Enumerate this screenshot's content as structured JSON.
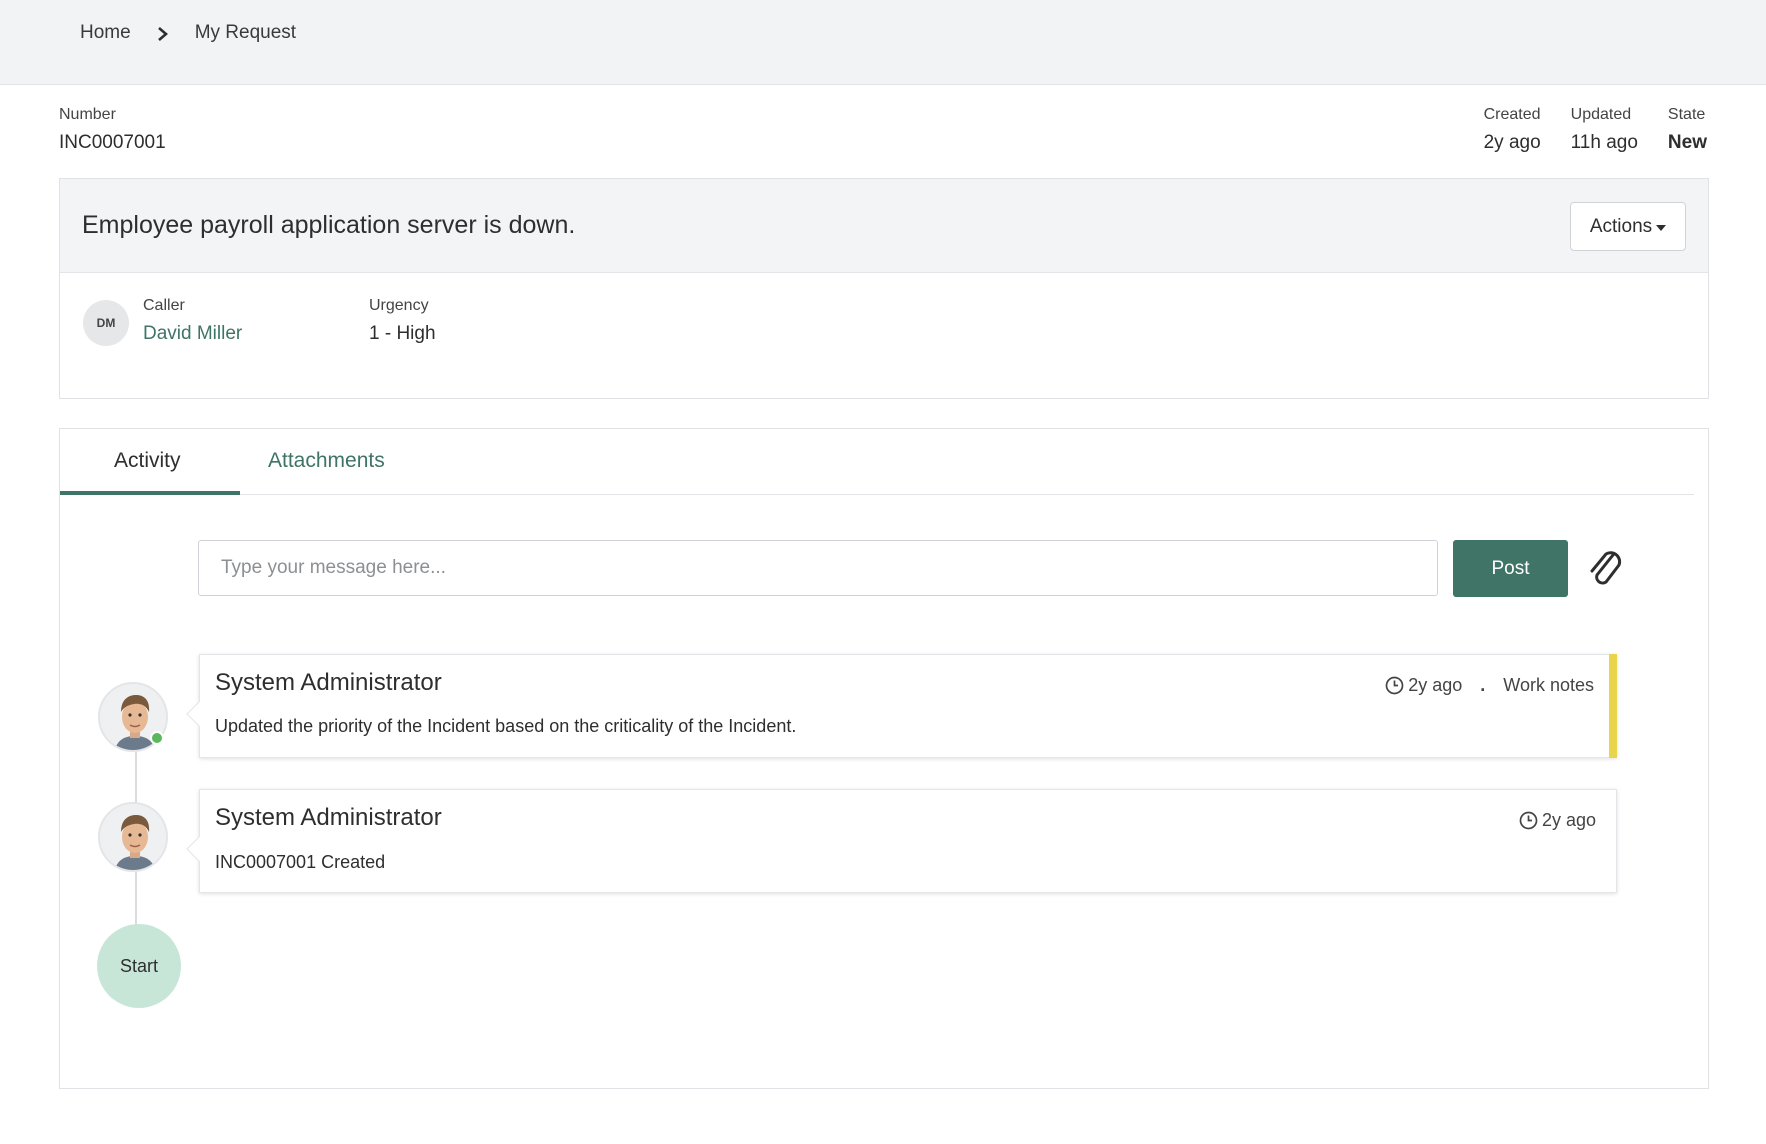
{
  "breadcrumb": {
    "home": "Home",
    "current": "My Request"
  },
  "ticket": {
    "number_label": "Number",
    "number": "INC0007001",
    "created_label": "Created",
    "created": "2y ago",
    "updated_label": "Updated",
    "updated": "11h ago",
    "state_label": "State",
    "state": "New"
  },
  "summary": {
    "title": "Employee payroll application server is down.",
    "actions_label": "Actions",
    "caller_initials": "DM",
    "caller_label": "Caller",
    "caller_name": "David Miller",
    "urgency_label": "Urgency",
    "urgency": "1 - High"
  },
  "tabs": {
    "activity": "Activity",
    "attachments": "Attachments"
  },
  "composer": {
    "placeholder": "Type your message here...",
    "post_label": "Post"
  },
  "timeline": {
    "entries": [
      {
        "author": "System Administrator",
        "time": "2y ago",
        "type": "Work notes",
        "text": "Updated the priority of the Incident based on the criticality of the Incident."
      },
      {
        "author": "System Administrator",
        "time": "2y ago",
        "text": "INC0007001 Created"
      }
    ],
    "start_label": "Start"
  },
  "colors": {
    "brand": "#3f7466",
    "work_notes_accent": "#e8d54a",
    "start_node": "#c7e6d8",
    "presence": "#5cb85c"
  },
  "icons": {
    "breadcrumb_separator": "chevron-right-icon",
    "actions_caret": "caret-down-icon",
    "attach": "paperclip-icon",
    "timestamp": "clock-icon"
  }
}
